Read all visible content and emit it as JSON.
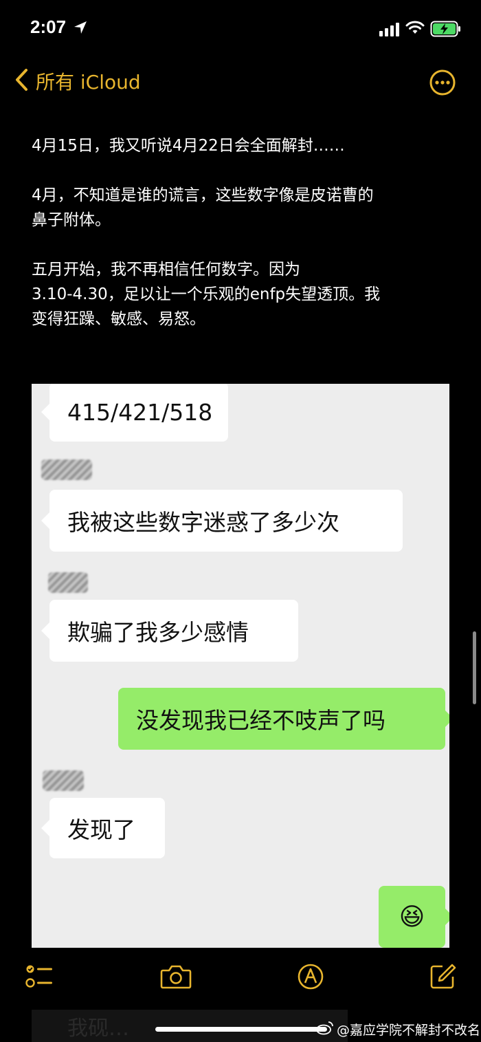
{
  "status_bar": {
    "time": "2:07"
  },
  "nav": {
    "back_label": "所有 iCloud"
  },
  "note": {
    "paragraphs": [
      "4月15日，我又听说4月22日会全面解封……",
      "4月，不知道是谁的谎言，这些数字像是皮诺曹的\n鼻子附体。",
      "五月开始，我不再相信任何数字。因为\n3.10-4.30，足以让一个乐观的enfp失望透顶。我\n变得狂躁、敏感、易怒。"
    ]
  },
  "chat": {
    "messages": [
      {
        "side": "left",
        "text": "415/421/518"
      },
      {
        "side": "left",
        "text": "我被这些数字迷惑了多少次"
      },
      {
        "side": "left",
        "text": "欺骗了我多少感情"
      },
      {
        "side": "right",
        "text": "没发现我已经不吱声了吗"
      },
      {
        "side": "left",
        "text": "发现了"
      },
      {
        "side": "right",
        "text": "😆"
      }
    ]
  },
  "bottom": {
    "bleed_text": "我砚…"
  },
  "watermark": {
    "text": "@嘉应学院不解封不改名"
  },
  "colors": {
    "accent": "#e8b52e",
    "chat_bg": "#ededed",
    "bubble_green": "#95ec69"
  },
  "icons": [
    "location-arrow-icon",
    "signal-icon",
    "wifi-icon",
    "battery-charging-icon",
    "chevron-left-icon",
    "ellipsis-circle-icon",
    "checklist-icon",
    "camera-icon",
    "markup-pen-icon",
    "compose-icon",
    "weibo-icon"
  ]
}
